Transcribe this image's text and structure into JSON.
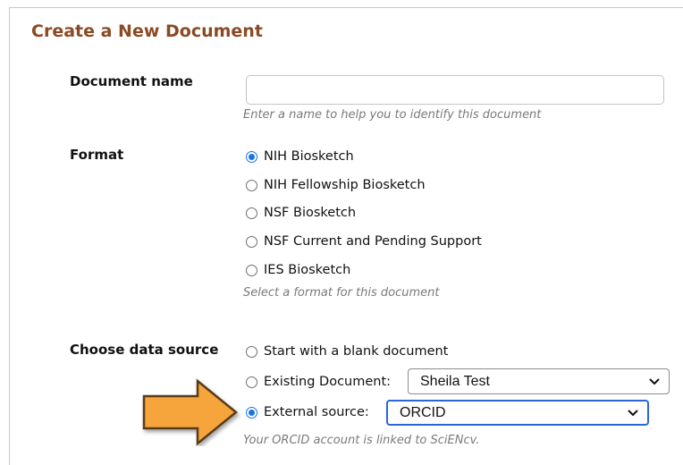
{
  "page": {
    "title": "Create a New Document"
  },
  "document_name": {
    "label": "Document name",
    "value": "",
    "placeholder": "",
    "hint": "Enter a name to help you to identify this document"
  },
  "format": {
    "label": "Format",
    "options": [
      {
        "label": "NIH Biosketch",
        "checked": true
      },
      {
        "label": "NIH Fellowship Biosketch",
        "checked": false
      },
      {
        "label": "NSF Biosketch",
        "checked": false
      },
      {
        "label": "NSF Current and Pending Support",
        "checked": false
      },
      {
        "label": "IES Biosketch",
        "checked": false
      }
    ],
    "hint": "Select a format for this document"
  },
  "data_source": {
    "label": "Choose data source",
    "options": [
      {
        "label": "Start with a blank document",
        "checked": false
      },
      {
        "label": "Existing Document:",
        "checked": false,
        "selected": "Sheila Test"
      },
      {
        "label": "External source:",
        "checked": true,
        "selected": "ORCID"
      }
    ],
    "hint": "Your ORCID account is linked to SciENcv."
  },
  "colors": {
    "title": "#8a4a23",
    "radio_checked": "#1a73e8",
    "arrow_fill": "#f5a53a",
    "arrow_stroke": "#5a3a12"
  },
  "icons": {
    "annotation_arrow": "right-arrow-icon",
    "select_caret": "chevron-down-icon"
  }
}
